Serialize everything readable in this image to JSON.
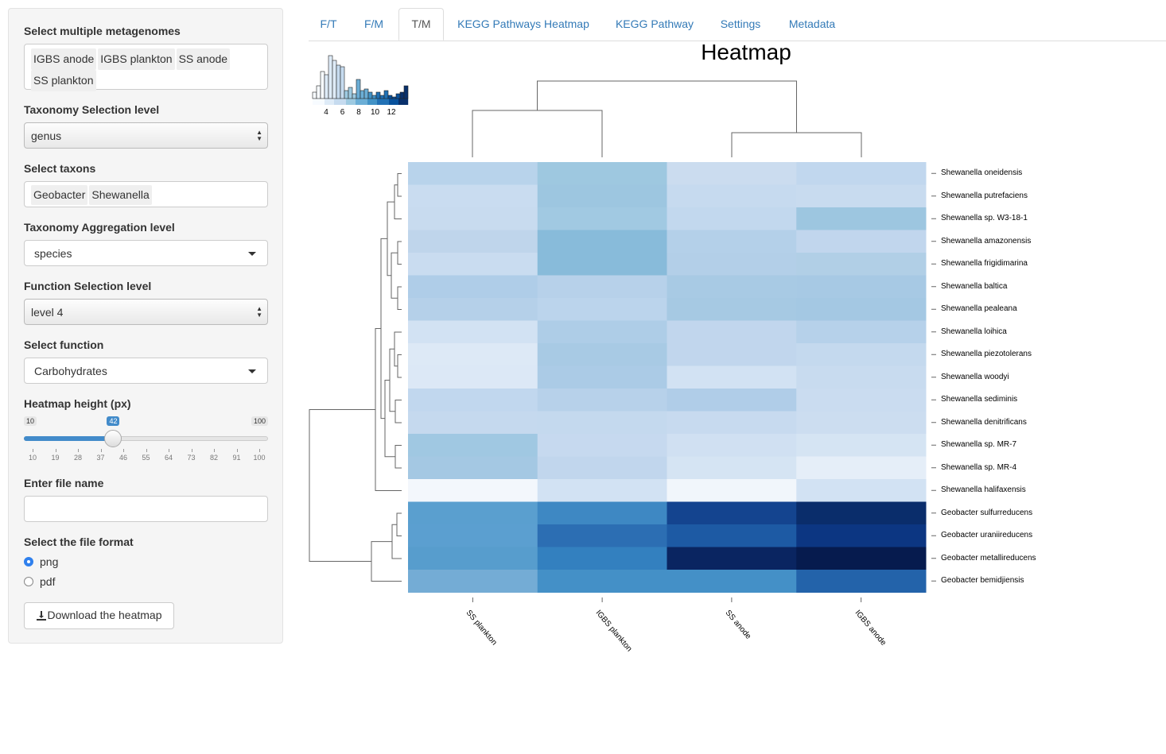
{
  "sidebar": {
    "metagenomes": {
      "label": "Select multiple metagenomes",
      "chips": [
        "IGBS anode",
        "IGBS plankton",
        "SS anode",
        "SS plankton"
      ]
    },
    "tax_sel": {
      "label": "Taxonomy Selection level",
      "value": "genus"
    },
    "taxons": {
      "label": "Select taxons",
      "chips": [
        "Geobacter",
        "Shewanella"
      ]
    },
    "tax_agg": {
      "label": "Taxonomy Aggregation level",
      "value": "species"
    },
    "func_sel": {
      "label": "Function Selection level",
      "value": "level 4"
    },
    "func": {
      "label": "Select function",
      "value": "Carbohydrates"
    },
    "height": {
      "label": "Heatmap height (px)",
      "min": "10",
      "max": "100",
      "value": "42",
      "fraction": 0.356,
      "ticks": [
        "10",
        "19",
        "28",
        "37",
        "46",
        "55",
        "64",
        "73",
        "82",
        "91",
        "100"
      ]
    },
    "filename": {
      "label": "Enter file name",
      "value": "",
      "placeholder": ""
    },
    "format": {
      "label": "Select the file format",
      "options": [
        "png",
        "pdf"
      ],
      "selected": "png"
    },
    "download_label": "Download the heatmap"
  },
  "tabs": [
    "F/T",
    "F/M",
    "T/M",
    "KEGG Pathways Heatmap",
    "KEGG Pathway",
    "Settings",
    "Metadata"
  ],
  "active_tab": "T/M",
  "heatmap": {
    "title": "Heatmap",
    "key_ticks": [
      "4",
      "6",
      "8",
      "10",
      "12"
    ],
    "columns": [
      "SS plankton",
      "IGBS plankton",
      "SS anode",
      "IGBS anode"
    ],
    "rows": [
      "Shewanella oneidensis",
      "Shewanella putrefaciens",
      "Shewanella sp. W3-18-1",
      "Shewanella amazonensis",
      "Shewanella frigidimarina",
      "Shewanella baltica",
      "Shewanella pealeana",
      "Shewanella loihica",
      "Shewanella piezotolerans",
      "Shewanella woodyi",
      "Shewanella sediminis",
      "Shewanella denitrificans",
      "Shewanella sp. MR-7",
      "Shewanella sp. MR-4",
      "Shewanella halifaxensis",
      "Geobacter sulfurreducens",
      "Geobacter uraniireducens",
      "Geobacter metallireducens",
      "Geobacter bemidjiensis"
    ],
    "colors": [
      [
        "#b8d3eb",
        "#9ec8e0",
        "#cbdcef",
        "#c1d7ee"
      ],
      [
        "#c9dcf0",
        "#9dc6e0",
        "#c6daef",
        "#c8dbef"
      ],
      [
        "#c8dbef",
        "#a1c9e2",
        "#c2d8ee",
        "#9dc6e0"
      ],
      [
        "#bfd5eb",
        "#88bbda",
        "#b4d0e9",
        "#c1d6ed"
      ],
      [
        "#c9dcf0",
        "#88bbda",
        "#b3cfe8",
        "#b1cfe6"
      ],
      [
        "#afcde8",
        "#b7d1ea",
        "#a8cae4",
        "#a7c9e4"
      ],
      [
        "#b5d0e9",
        "#bbd4ec",
        "#a6c9e3",
        "#a4c8e3"
      ],
      [
        "#d2e2f3",
        "#aecde7",
        "#c1d6ed",
        "#b6d1ea"
      ],
      [
        "#dde9f6",
        "#a8cae4",
        "#c1d6ed",
        "#c4d9ee"
      ],
      [
        "#dce8f6",
        "#abcbe6",
        "#d2e2f3",
        "#c8dbef"
      ],
      [
        "#c1d7ee",
        "#b7d1ea",
        "#b0cde8",
        "#cadcf0"
      ],
      [
        "#c5d9ee",
        "#c4d9ee",
        "#c7daef",
        "#ccddf0"
      ],
      [
        "#a0c8e2",
        "#c6d9ef",
        "#d0e0f2",
        "#d5e4f3"
      ],
      [
        "#a4c8e3",
        "#c1d6ed",
        "#d5e4f3",
        "#e5eef8"
      ],
      [
        "#f3f7fc",
        "#d2e2f3",
        "#f1f6fb",
        "#d2e2f3"
      ],
      [
        "#5a9fcf",
        "#3e88c3",
        "#14448f",
        "#0a2d6b"
      ],
      [
        "#5b9fd0",
        "#2c6eb3",
        "#1d5aa4",
        "#0c3682"
      ],
      [
        "#579dcd",
        "#3380bf",
        "#0a2561",
        "#061b4e"
      ],
      [
        "#74acd5",
        "#4490c7",
        "#4490c7",
        "#2363aa"
      ]
    ]
  }
}
